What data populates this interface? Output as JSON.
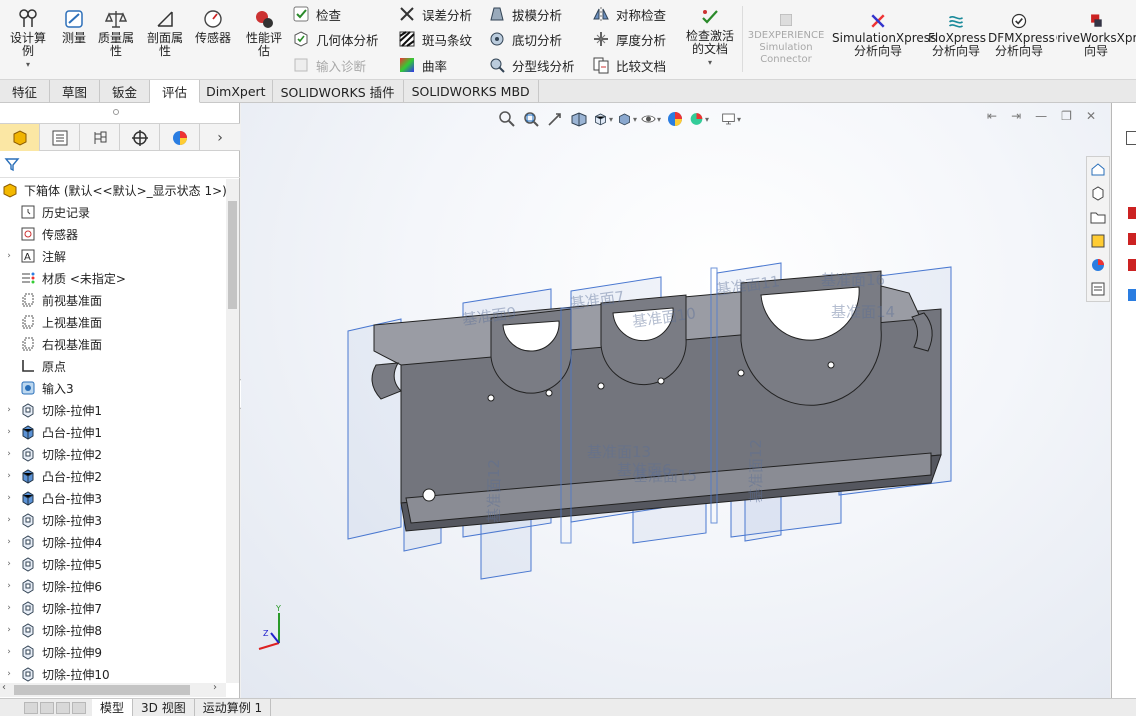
{
  "ribbon": {
    "design_study": "设计算例",
    "measure": "测量",
    "mass_properties": "质量属性",
    "section_properties": "剖面属性",
    "sensors": "传感器",
    "performance_eval": "性能评估",
    "check": "检查",
    "geometry_analysis": "几何体分析",
    "import_diagnostics": "输入诊断",
    "deviation_analysis": "误差分析",
    "zebra_stripes": "斑马条纹",
    "curvature": "曲率",
    "draft_analysis": "拔模分析",
    "undercut_analysis": "底切分析",
    "parting_line_analysis": "分型线分析",
    "symmetry_check": "对称检查",
    "thickness_analysis": "厚度分析",
    "compare_documents": "比较文档",
    "check_active_doc": "检查激活的文档",
    "experience_sim": "3DEXPERIENCE Simulation Connector",
    "simxpress": "SimulationXpress 分析向导",
    "floxpress": "FloXpress 分析向导",
    "dfmxpress": "DFMXpress 分析向导",
    "driveworks": "DriveWorksXpress 向导"
  },
  "command_tabs": [
    "特征",
    "草图",
    "钣金",
    "评估",
    "DimXpert",
    "SOLIDWORKS 插件",
    "SOLIDWORKS MBD"
  ],
  "active_command_tab": "评估",
  "tree": {
    "root": "下箱体 (默认<<默认>_显示状态 1>)",
    "items": [
      {
        "label": "历史记录",
        "icon": "history-icon",
        "expand": false
      },
      {
        "label": "传感器",
        "icon": "sensor-icon",
        "expand": false
      },
      {
        "label": "注解",
        "icon": "annotation-icon",
        "expand": true
      },
      {
        "label": "材质 <未指定>",
        "icon": "material-icon",
        "expand": false
      },
      {
        "label": "前视基准面",
        "icon": "plane-icon",
        "expand": false
      },
      {
        "label": "上视基准面",
        "icon": "plane-icon",
        "expand": false
      },
      {
        "label": "右视基准面",
        "icon": "plane-icon",
        "expand": false
      },
      {
        "label": "原点",
        "icon": "origin-icon",
        "expand": false
      },
      {
        "label": "输入3",
        "icon": "import-icon",
        "expand": false
      },
      {
        "label": "切除-拉伸1",
        "icon": "cut-icon",
        "expand": true
      },
      {
        "label": "凸台-拉伸1",
        "icon": "boss-icon",
        "expand": true
      },
      {
        "label": "切除-拉伸2",
        "icon": "cut-icon",
        "expand": true
      },
      {
        "label": "凸台-拉伸2",
        "icon": "boss-icon",
        "expand": true
      },
      {
        "label": "凸台-拉伸3",
        "icon": "boss-icon",
        "expand": true
      },
      {
        "label": "切除-拉伸3",
        "icon": "cut-icon",
        "expand": true
      },
      {
        "label": "切除-拉伸4",
        "icon": "cut-icon",
        "expand": true
      },
      {
        "label": "切除-拉伸5",
        "icon": "cut-icon",
        "expand": true
      },
      {
        "label": "切除-拉伸6",
        "icon": "cut-icon",
        "expand": true
      },
      {
        "label": "切除-拉伸7",
        "icon": "cut-icon",
        "expand": true
      },
      {
        "label": "切除-拉伸8",
        "icon": "cut-icon",
        "expand": true
      },
      {
        "label": "切除-拉伸9",
        "icon": "cut-icon",
        "expand": true
      },
      {
        "label": "切除-拉伸10",
        "icon": "cut-icon",
        "expand": true
      }
    ]
  },
  "viewport": {
    "plane_labels": [
      "基准面16",
      "基准面14",
      "基准面9",
      "基准面7",
      "基准面10",
      "基准面11",
      "基准面13",
      "基准面6",
      "基准面15",
      "基准面12",
      "基准面12"
    ],
    "triad": {
      "y": "Y",
      "z": "Z"
    }
  },
  "bottom_tabs": [
    "模型",
    "3D 视图",
    "运动算例 1"
  ],
  "active_bottom_tab": "模型",
  "colors": {
    "accent": "#1f6fc2",
    "plane": "#4a78d0",
    "model": "#6e7078",
    "active_tab": "#fbe7a4"
  }
}
